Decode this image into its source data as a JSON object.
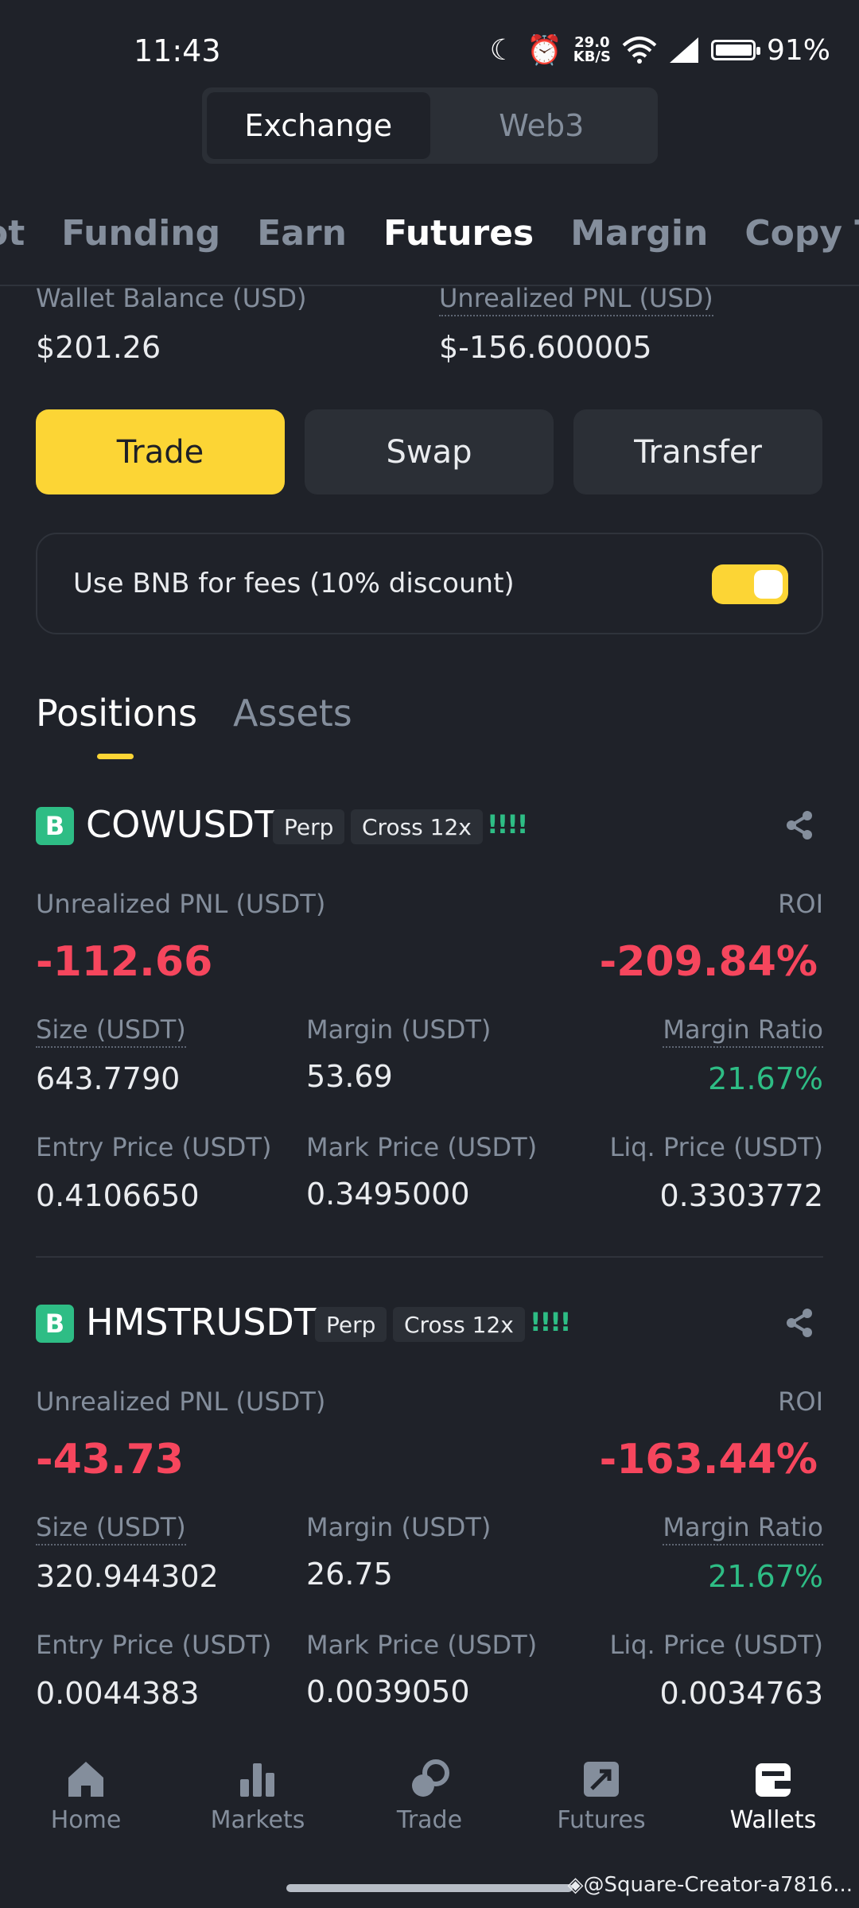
{
  "status": {
    "time": "11:43",
    "net_speed_top": "29.0",
    "net_speed_bottom": "KB/S",
    "battery": "91%"
  },
  "switch": {
    "exchange": "Exchange",
    "web3": "Web3"
  },
  "tabs": [
    "ot",
    "Funding",
    "Earn",
    "Futures",
    "Margin",
    "Copy Trac"
  ],
  "balance": {
    "wallet_label": "Wallet Balance (USD)",
    "wallet_value": "$201.26",
    "pnl_label": "Unrealized PNL (USD)",
    "pnl_value": "$-156.600005"
  },
  "actions": {
    "trade": "Trade",
    "swap": "Swap",
    "transfer": "Transfer"
  },
  "fee": {
    "text": "Use BNB for fees (10% discount)",
    "enabled": true
  },
  "position_tabs": {
    "positions": "Positions",
    "assets": "Assets"
  },
  "labels": {
    "badge": "B",
    "perp": "Perp",
    "unrealized_pnl": "Unrealized PNL (USDT)",
    "roi": "ROI",
    "size": "Size (USDT)",
    "margin": "Margin (USDT)",
    "margin_ratio": "Margin Ratio",
    "entry_price": "Entry Price (USDT)",
    "mark_price": "Mark Price (USDT)",
    "liq_price": "Liq. Price (USDT)",
    "bars": "!!!!"
  },
  "positions": [
    {
      "symbol": "COWUSDT",
      "leverage": "Cross 12x",
      "pnl": "-112.66",
      "roi": "-209.84%",
      "size": "643.7790",
      "margin": "53.69",
      "margin_ratio": "21.67%",
      "entry_price": "0.4106650",
      "mark_price": "0.3495000",
      "liq_price": "0.3303772"
    },
    {
      "symbol": "HMSTRUSDT",
      "leverage": "Cross 12x",
      "pnl": "-43.73",
      "roi": "-163.44%",
      "size": "320.944302",
      "margin": "26.75",
      "margin_ratio": "21.67%",
      "entry_price": "0.0044383",
      "mark_price": "0.0039050",
      "liq_price": "0.0034763"
    }
  ],
  "nav": [
    "Home",
    "Markets",
    "Trade",
    "Futures",
    "Wallets"
  ],
  "watermark": "@Square-Creator-a7816...",
  "colors": {
    "accent": "#fcd535",
    "loss": "#f6465d",
    "gain": "#2ebd85",
    "bg": "#1f2229"
  }
}
